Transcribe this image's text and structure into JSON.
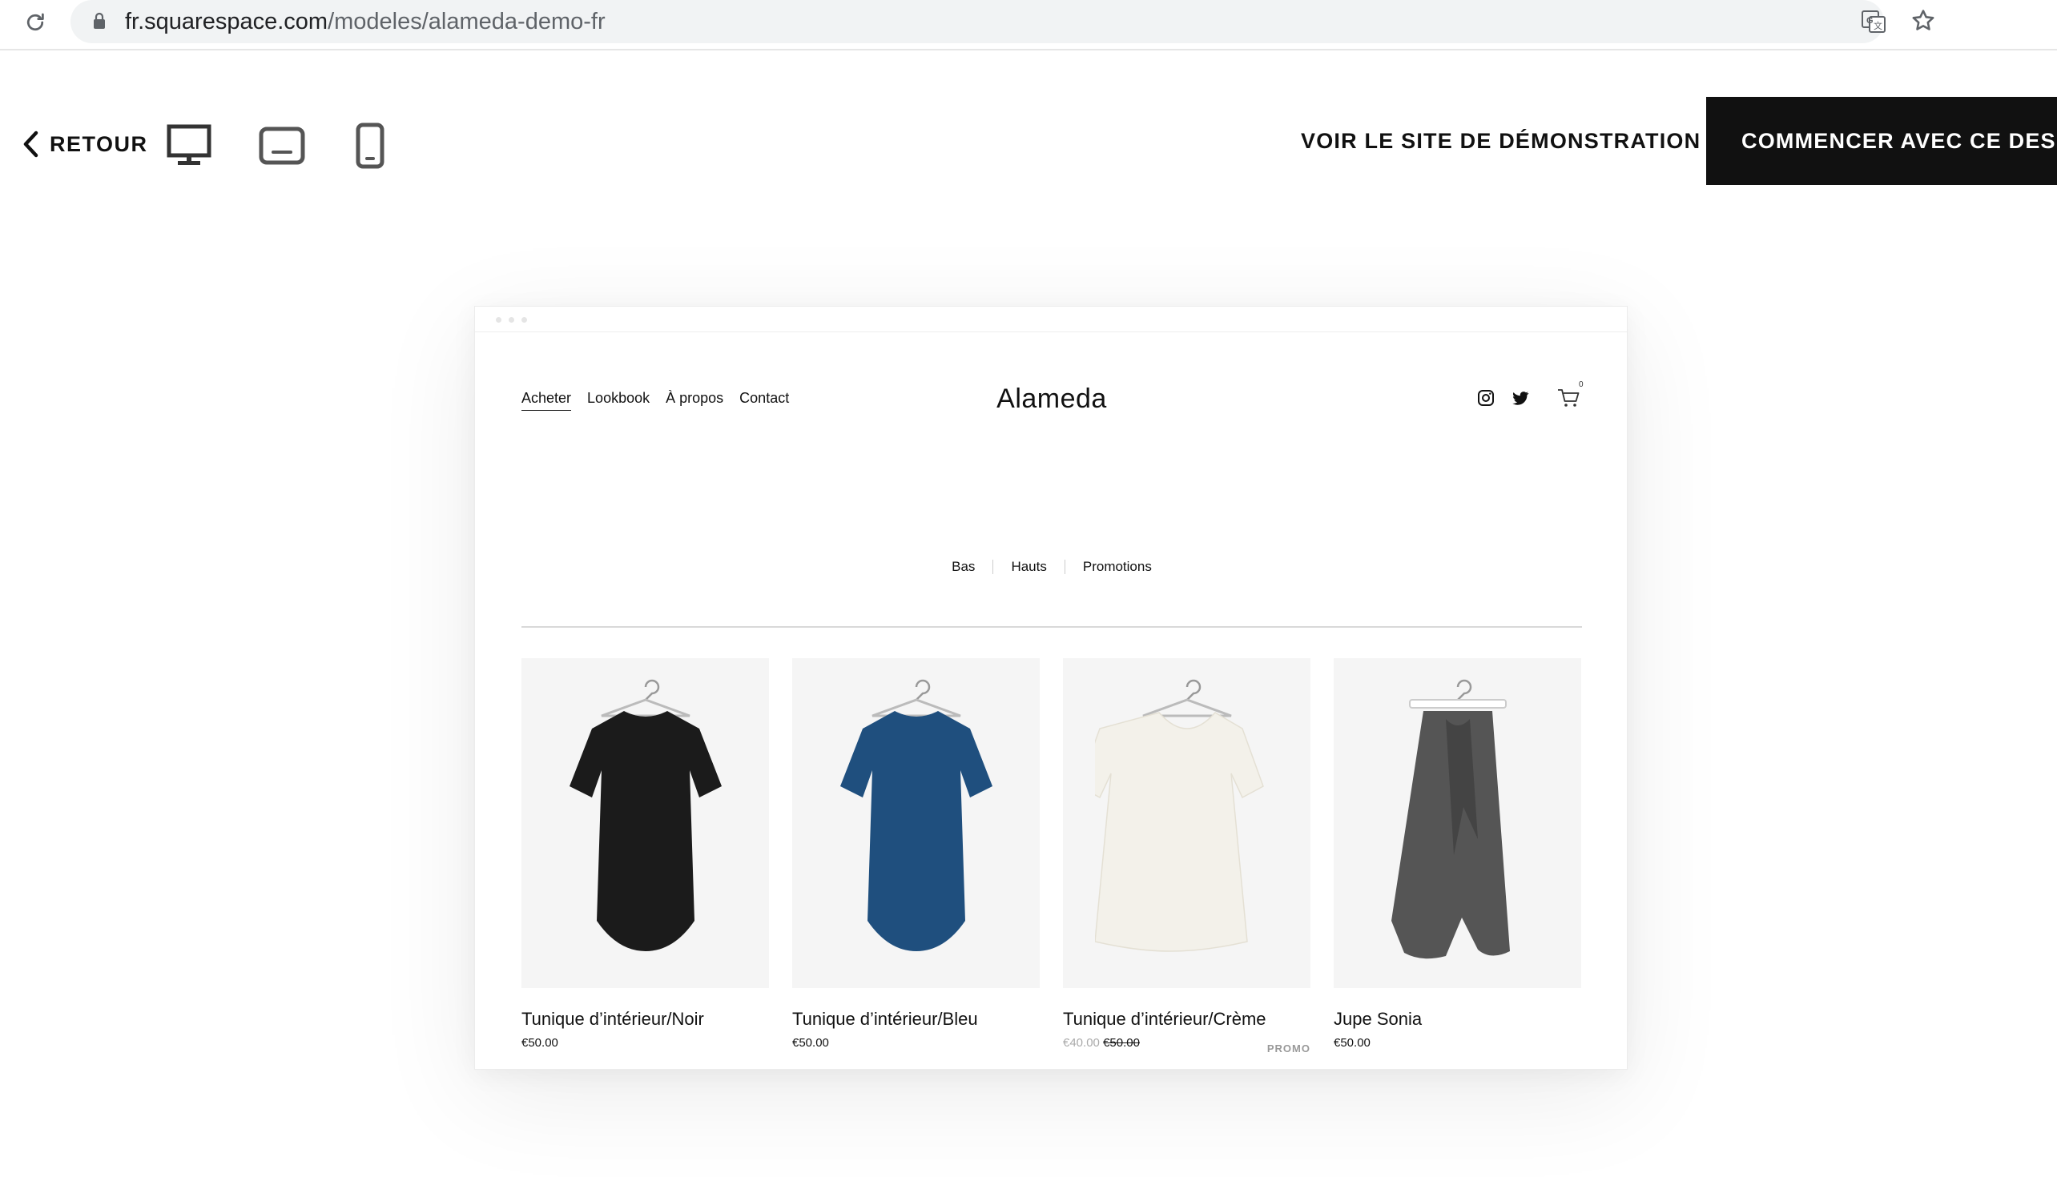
{
  "browser": {
    "url_host": "fr.squarespace.com",
    "url_path": "/modeles/alameda-demo-fr"
  },
  "toolbar": {
    "back_label": "RETOUR",
    "demo_link": "VOIR LE SITE DE DÉMONSTRATION",
    "start_button": "COMMENCER AVEC CE DESIGN"
  },
  "site": {
    "title": "Alameda",
    "nav": [
      "Acheter",
      "Lookbook",
      "À propos",
      "Contact"
    ],
    "cart_count": "0",
    "categories": [
      "Bas",
      "Hauts",
      "Promotions"
    ]
  },
  "products": [
    {
      "name": "Tunique d’intérieur/Noir",
      "price": "€50.00",
      "color": "#1b1b1b"
    },
    {
      "name": "Tunique d’intérieur/Bleu",
      "price": "€50.00",
      "color": "#1f4f7e"
    },
    {
      "name": "Tunique d’intérieur/Crème",
      "price_sale": "€40.00",
      "price_original": "€50.00",
      "badge": "PROMO",
      "color": "#f3f1ea"
    },
    {
      "name": "Jupe Sonia",
      "price": "€50.00",
      "color": "#555555"
    }
  ]
}
